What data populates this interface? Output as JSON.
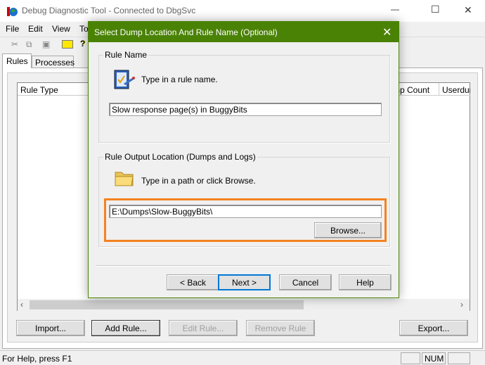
{
  "window": {
    "title": "Debug Diagnostic Tool - Connected to DbgSvc",
    "controls": {
      "minimize": "—",
      "maximize": "☐",
      "close": "✕"
    }
  },
  "menu": [
    "File",
    "Edit",
    "View",
    "Tools"
  ],
  "tabs": [
    {
      "label": "Rules",
      "active": true
    },
    {
      "label": "Processes",
      "active": false
    }
  ],
  "list": {
    "columns": [
      "Rule Type",
      "mp Count",
      "Userdur"
    ]
  },
  "buttons": {
    "import": "Import...",
    "add_rule": "Add Rule...",
    "edit_rule": "Edit Rule...",
    "remove_rule": "Remove Rule",
    "export": "Export..."
  },
  "status": {
    "help": "For Help, press F1",
    "num": "NUM"
  },
  "dialog": {
    "title": "Select Dump Location And Rule Name (Optional)",
    "title_color": "#4a8206",
    "rule_name": {
      "legend": "Rule Name",
      "hint": "Type in a rule name.",
      "value": "Slow response page(s) in BuggyBits"
    },
    "output": {
      "legend": "Rule Output Location (Dumps and Logs)",
      "hint": "Type in a path or click Browse.",
      "value": "E:\\Dumps\\Slow-BuggyBits\\",
      "browse": "Browse...",
      "highlight_color": "#f58220"
    },
    "buttons": {
      "back": "< Back",
      "next": "Next >",
      "cancel": "Cancel",
      "help": "Help"
    }
  }
}
